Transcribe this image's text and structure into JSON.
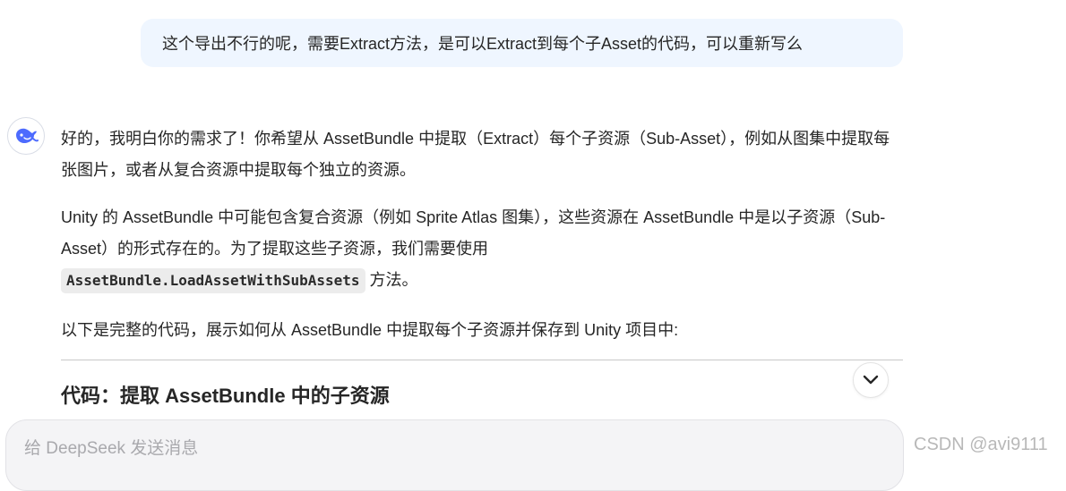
{
  "conversation": {
    "user_message": "这个导出不行的呢，需要Extract方法，是可以Extract到每个子Asset的代码，可以重新写么",
    "assistant": {
      "avatar_icon": "deepseek-whale-icon",
      "paragraph1": "好的，我明白你的需求了！你希望从 AssetBundle 中提取（Extract）每个子资源（Sub-Asset），例如从图集中提取每张图片，或者从复合资源中提取每个独立的资源。",
      "paragraph2_text": "Unity 的 AssetBundle 中可能包含复合资源（例如 Sprite Atlas 图集），这些资源在 AssetBundle 中是以子资源（Sub-Asset）的形式存在的。为了提取这些子资源，我们需要使用",
      "paragraph2_code": "AssetBundle.LoadAssetWithSubAssets",
      "paragraph2_suffix": " 方法。",
      "paragraph3": "以下是完整的代码，展示如何从 AssetBundle 中提取每个子资源并保存到 Unity 项目中:",
      "heading": "代码：提取 AssetBundle 中的子资源"
    }
  },
  "composer": {
    "placeholder": "给 DeepSeek 发送消息"
  },
  "watermark": "CSDN @avi9111",
  "colors": {
    "accent": "#4d6bfe",
    "user_bubble": "#eff6ff"
  }
}
